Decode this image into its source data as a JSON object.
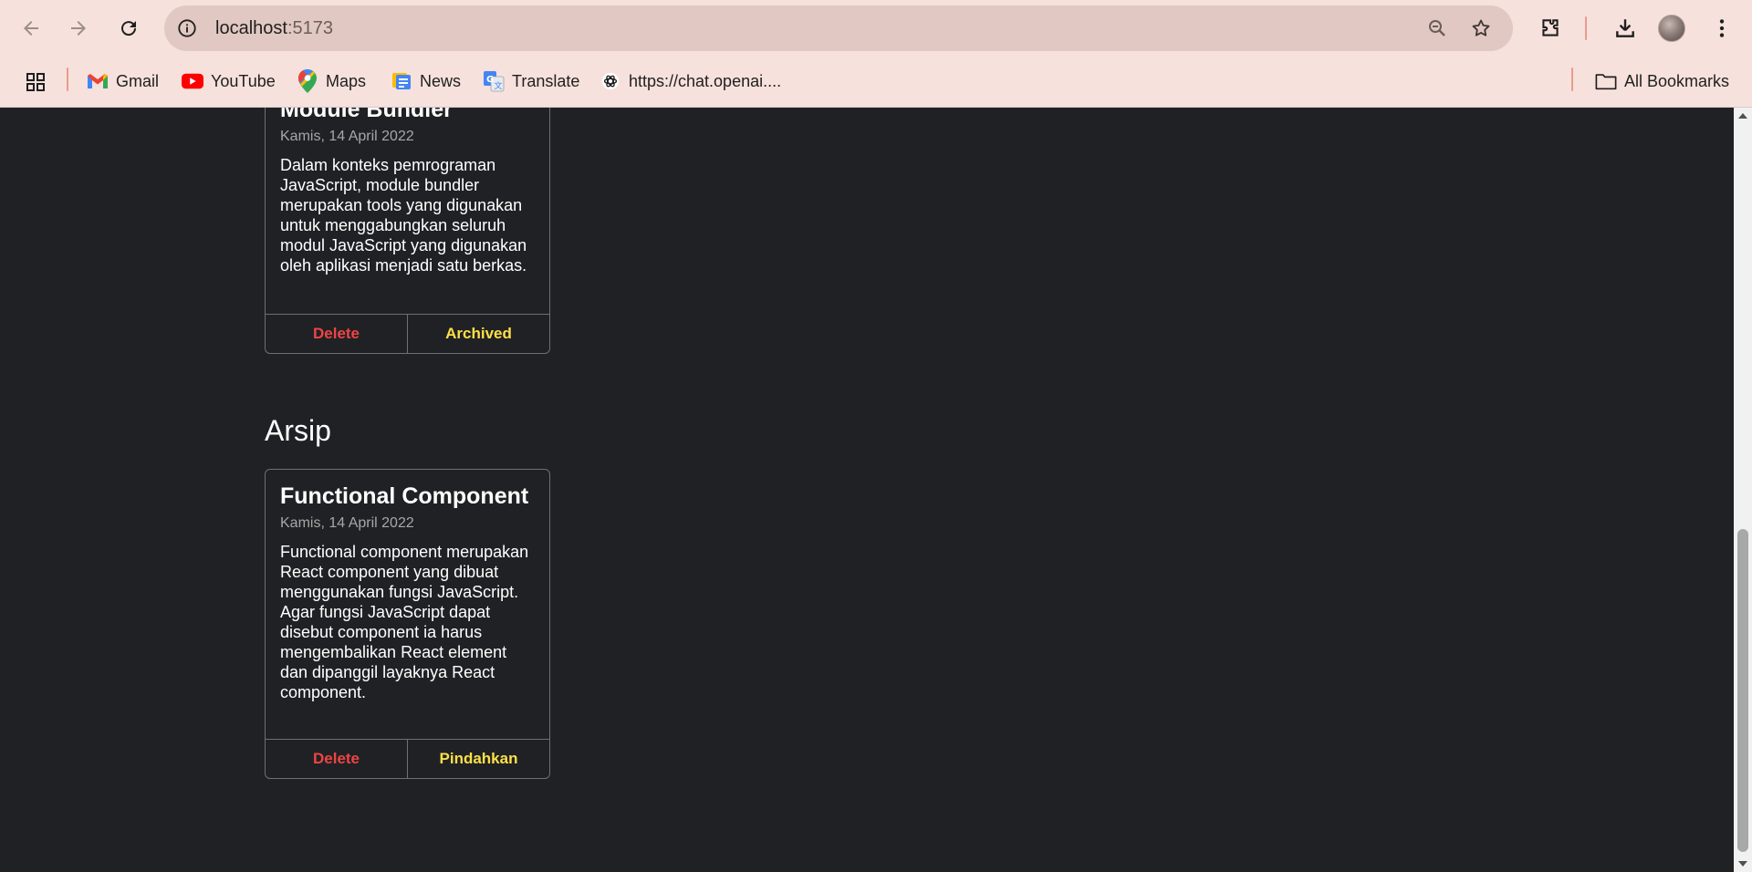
{
  "browser": {
    "url_host": "localhost",
    "url_port": ":5173",
    "bookmarks": [
      {
        "label": "Gmail",
        "icon": "gmail-icon"
      },
      {
        "label": "YouTube",
        "icon": "youtube-icon"
      },
      {
        "label": "Maps",
        "icon": "maps-icon"
      },
      {
        "label": "News",
        "icon": "news-icon"
      },
      {
        "label": "Translate",
        "icon": "translate-icon"
      },
      {
        "label": "https://chat.openai....",
        "icon": "openai-icon"
      }
    ],
    "all_bookmarks_label": "All Bookmarks"
  },
  "active_notes": [
    {
      "title": "Module Bundler",
      "date": "Kamis, 14 April 2022",
      "body": "Dalam konteks pemrograman JavaScript, module bundler merupakan tools yang digunakan untuk menggabungkan seluruh modul JavaScript yang digunakan oleh aplikasi menjadi satu berkas.",
      "delete_label": "Delete",
      "action_label": "Archived"
    }
  ],
  "archive": {
    "heading": "Arsip",
    "notes": [
      {
        "title": "Functional Component",
        "date": "Kamis, 14 April 2022",
        "body": "Functional component merupakan React component yang dibuat menggunakan fungsi JavaScript. Agar fungsi JavaScript dapat disebut component ia harus mengembalikan React element dan dipanggil layaknya React component.",
        "delete_label": "Delete",
        "action_label": "Pindahkan"
      }
    ]
  },
  "colors": {
    "page_bg": "#202124",
    "delete": "#ef4444",
    "action": "#fde047",
    "chrome_bg": "#f6e1dc"
  }
}
